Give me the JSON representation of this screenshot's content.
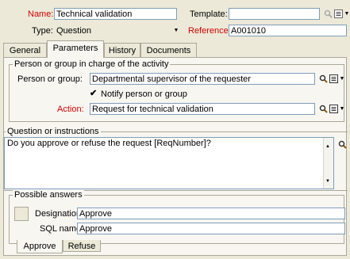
{
  "header": {
    "name_label": "Name:",
    "name_value": "Technical validation",
    "template_label": "Template:",
    "template_value": "",
    "type_label": "Type:",
    "type_value": "Question",
    "reference_label": "Reference:",
    "reference_value": "A001010"
  },
  "tabs": [
    {
      "label": "General",
      "active": false
    },
    {
      "label": "Parameters",
      "active": true
    },
    {
      "label": "History",
      "active": false
    },
    {
      "label": "Documents",
      "active": false
    }
  ],
  "person_group": {
    "title": "Person or group in charge of the activity",
    "field_label": "Person or group:",
    "field_value": "Departmental supervisor of the requester",
    "notify_label": "Notify person or group",
    "notify_checked": true,
    "action_label": "Action:",
    "action_value": "Request for technical validation"
  },
  "question": {
    "title": "Question or instructions",
    "text": "Do you approve or refuse the request [ReqNumber]?"
  },
  "answers": {
    "title": "Possible answers",
    "designation_label": "Designation:",
    "designation_value": "Approve",
    "sql_label": "SQL name:",
    "sql_value": "Approve",
    "tabs": [
      {
        "label": "Approve",
        "active": true
      },
      {
        "label": "Refuse",
        "active": false
      }
    ]
  },
  "icons": {
    "zoom": "magnifier-icon",
    "details": "details-icon",
    "dropdown": "dropdown-arrow-icon",
    "check": "checkmark-icon"
  },
  "colors": {
    "mandatory_label": "#d40000",
    "window_bg": "#ece9d8",
    "panel_bg": "#f7f6f1",
    "field_border": "#7f9db9"
  }
}
